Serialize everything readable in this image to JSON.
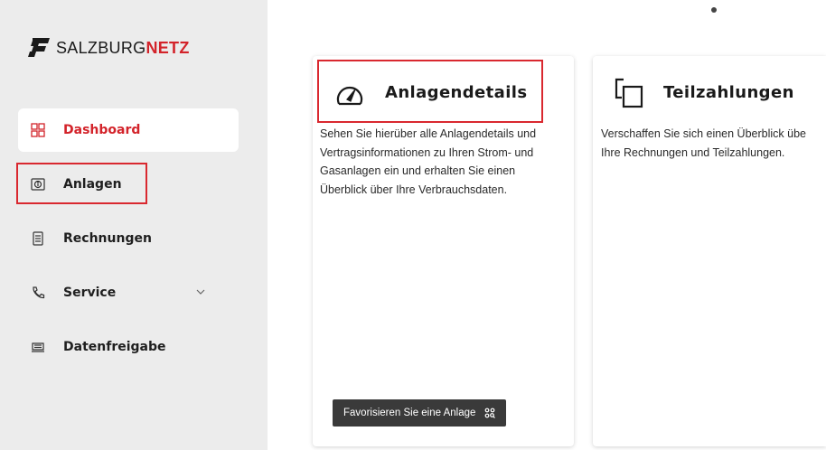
{
  "brand": {
    "name_part1": "SALZBURG",
    "name_part2": "NETZ",
    "accent_color": "#d3232a"
  },
  "sidebar": {
    "items": [
      {
        "label": "Dashboard",
        "icon": "grid-icon",
        "active": true
      },
      {
        "label": "Anlagen",
        "icon": "info-box-icon",
        "active": false
      },
      {
        "label": "Rechnungen",
        "icon": "document-icon",
        "active": false
      },
      {
        "label": "Service",
        "icon": "phone-icon",
        "active": false,
        "has_submenu": true
      },
      {
        "label": "Datenfreigabe",
        "icon": "monitor-icon",
        "active": false
      }
    ]
  },
  "cards": [
    {
      "title": "Anlagendetails",
      "icon": "speedometer-icon",
      "text": "Sehen Sie hierüber alle Anlagendetails und Vertragsinformationen zu Ihren Strom- und Gasanlagen ein und erhalten Sie einen Überblick über Ihre Verbrauchsdaten.",
      "button_label": "Favorisieren Sie eine Anlage",
      "button_icon": "qr-search-icon"
    },
    {
      "title": "Teilzahlungen",
      "icon": "copy-icon",
      "text_line1": "Verschaffen Sie sich einen Überblick übe",
      "text_line2": "Ihre Rechnungen und Teilzahlungen."
    }
  ],
  "highlight_color": "#d9282f"
}
